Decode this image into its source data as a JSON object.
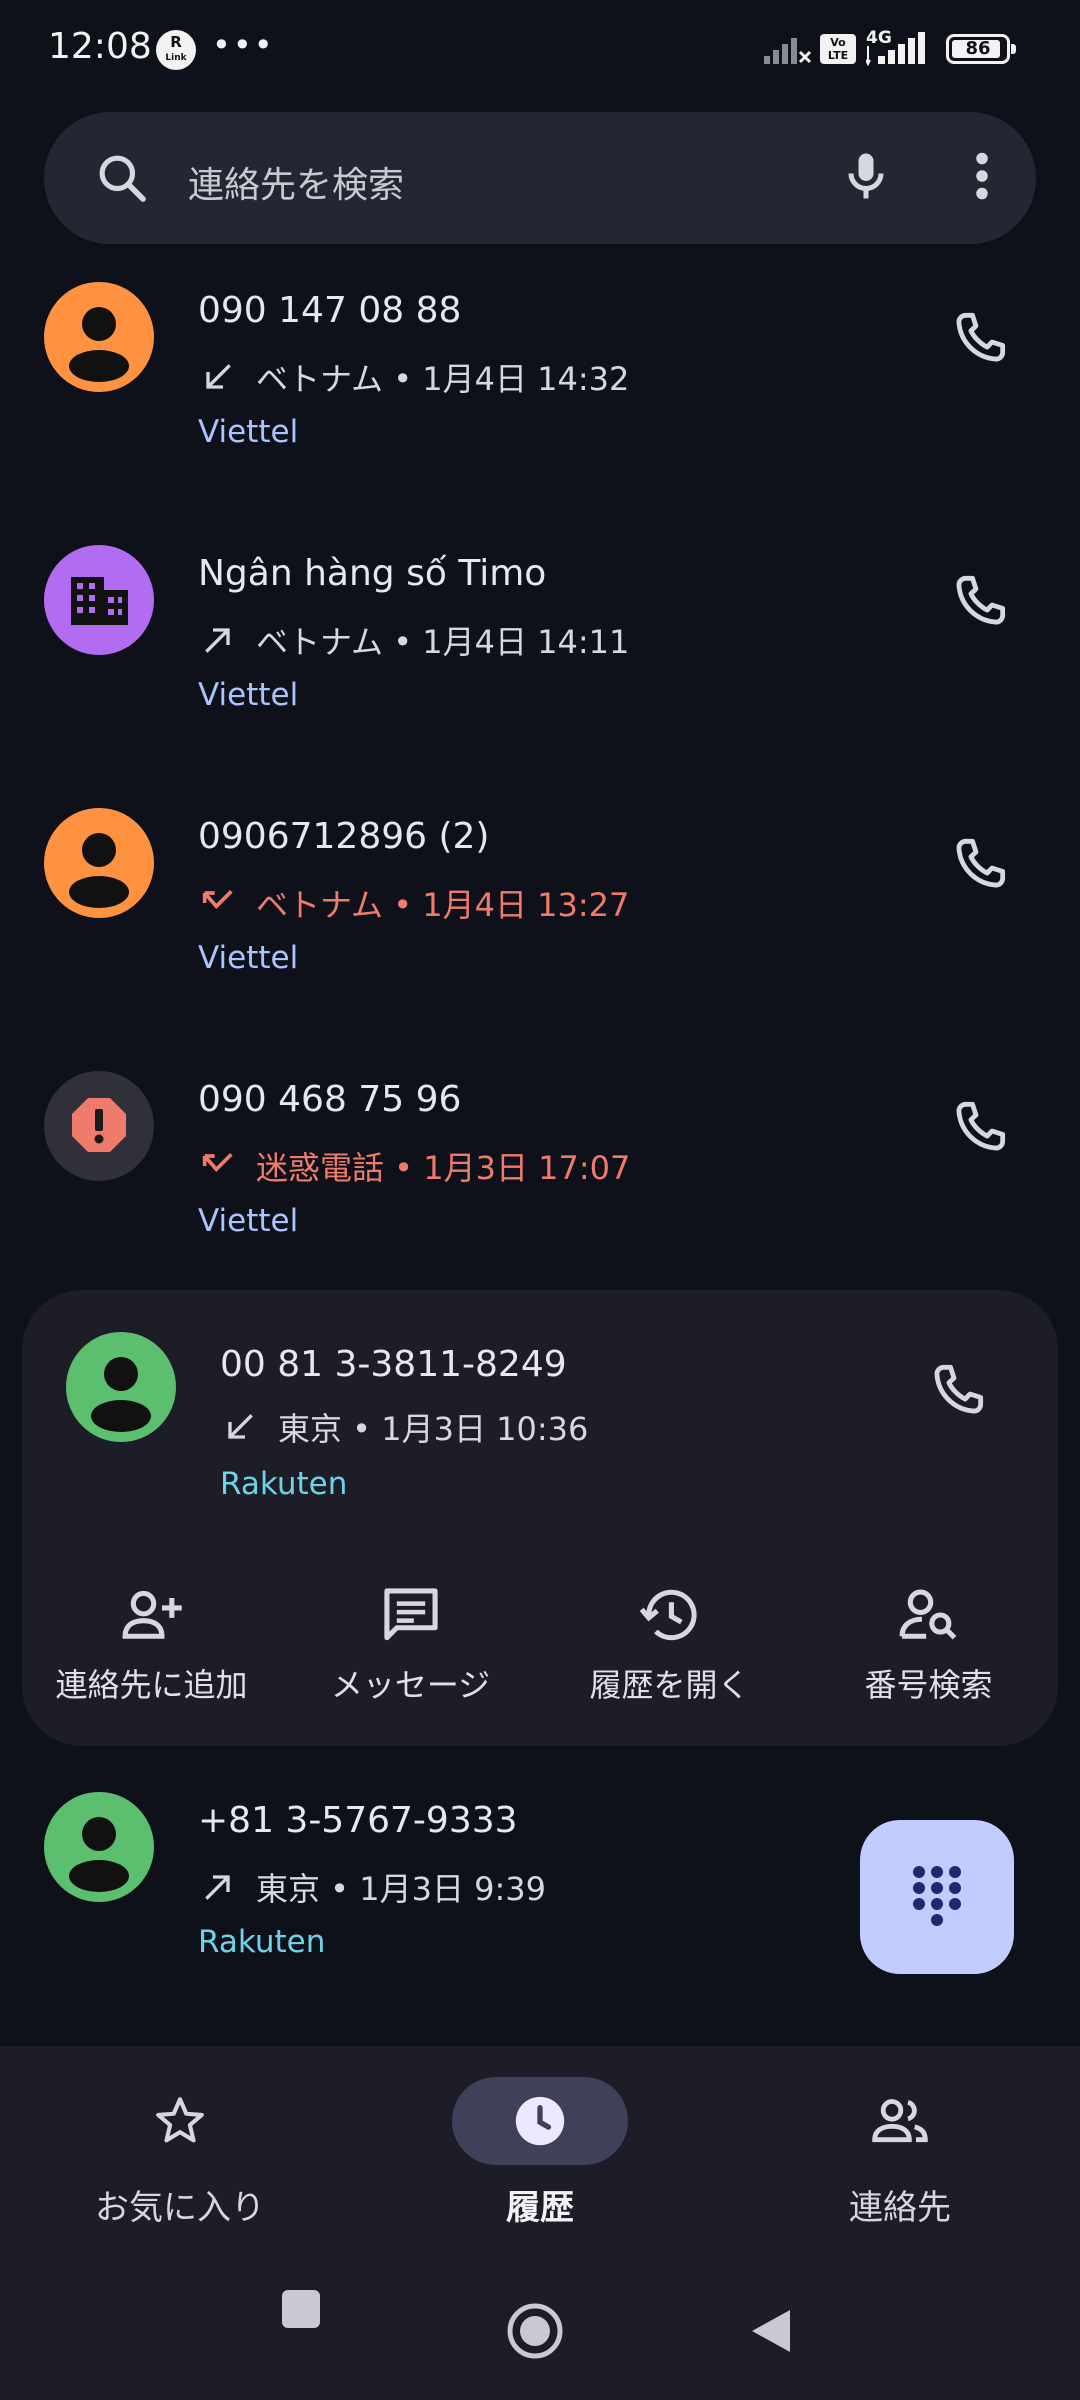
{
  "status_bar": {
    "time": "12:08",
    "r_link_badge": "R",
    "r_link_sub": "Link",
    "volte": "Vo LTE",
    "network": "4G",
    "battery": "86"
  },
  "search": {
    "placeholder": "連絡先を検索"
  },
  "calls": [
    {
      "name": "090 147 08 88",
      "direction": "incoming",
      "detail": "ベトナム • 1月4日 14:32",
      "carrier": "Viettel",
      "avatar": "person",
      "avatar_color": "#ff9240",
      "missed": false
    },
    {
      "name": "Ngân hàng số Timo",
      "direction": "outgoing",
      "detail": "ベトナム • 1月4日 14:11",
      "carrier": "Viettel",
      "avatar": "business",
      "avatar_color": "#b26cf2",
      "missed": false
    },
    {
      "name": "0906712896  (2)",
      "direction": "missed",
      "detail": "ベトナム • 1月4日 13:27",
      "carrier": "Viettel",
      "avatar": "person",
      "avatar_color": "#ff9240",
      "missed": true
    },
    {
      "name": "090 468 75 96",
      "direction": "missed",
      "detail": "迷惑電話 • 1月3日 17:07",
      "carrier": "Viettel",
      "avatar": "spam",
      "avatar_color": "#2f3038",
      "missed": true
    },
    {
      "name": "00 81 3-3811-8249",
      "direction": "incoming",
      "detail": "東京 • 1月3日 10:36",
      "carrier": "Rakuten",
      "avatar": "person",
      "avatar_color": "#5cbf6f",
      "missed": false
    },
    {
      "name": "+81 3-5767-9333",
      "direction": "outgoing",
      "detail": "東京 • 1月3日 9:39",
      "carrier": "Rakuten",
      "avatar": "person",
      "avatar_color": "#5cbf6f",
      "missed": false
    }
  ],
  "expanded_actions": [
    {
      "label": "連絡先に追加",
      "icon": "person-add-icon"
    },
    {
      "label": "メッセージ",
      "icon": "message-icon"
    },
    {
      "label": "履歴を開く",
      "icon": "history-icon"
    },
    {
      "label": "番号検索",
      "icon": "person-search-icon"
    }
  ],
  "bottom_nav": {
    "favorites": "お気に入り",
    "recents": "履歴",
    "contacts": "連絡先",
    "active": "recents"
  },
  "colors": {
    "background": "#0f111a",
    "missed": "#f07a6c",
    "viettel": "#a9c4ff",
    "rakuten": "#6fd3e8",
    "fab": "#c3ccff"
  }
}
